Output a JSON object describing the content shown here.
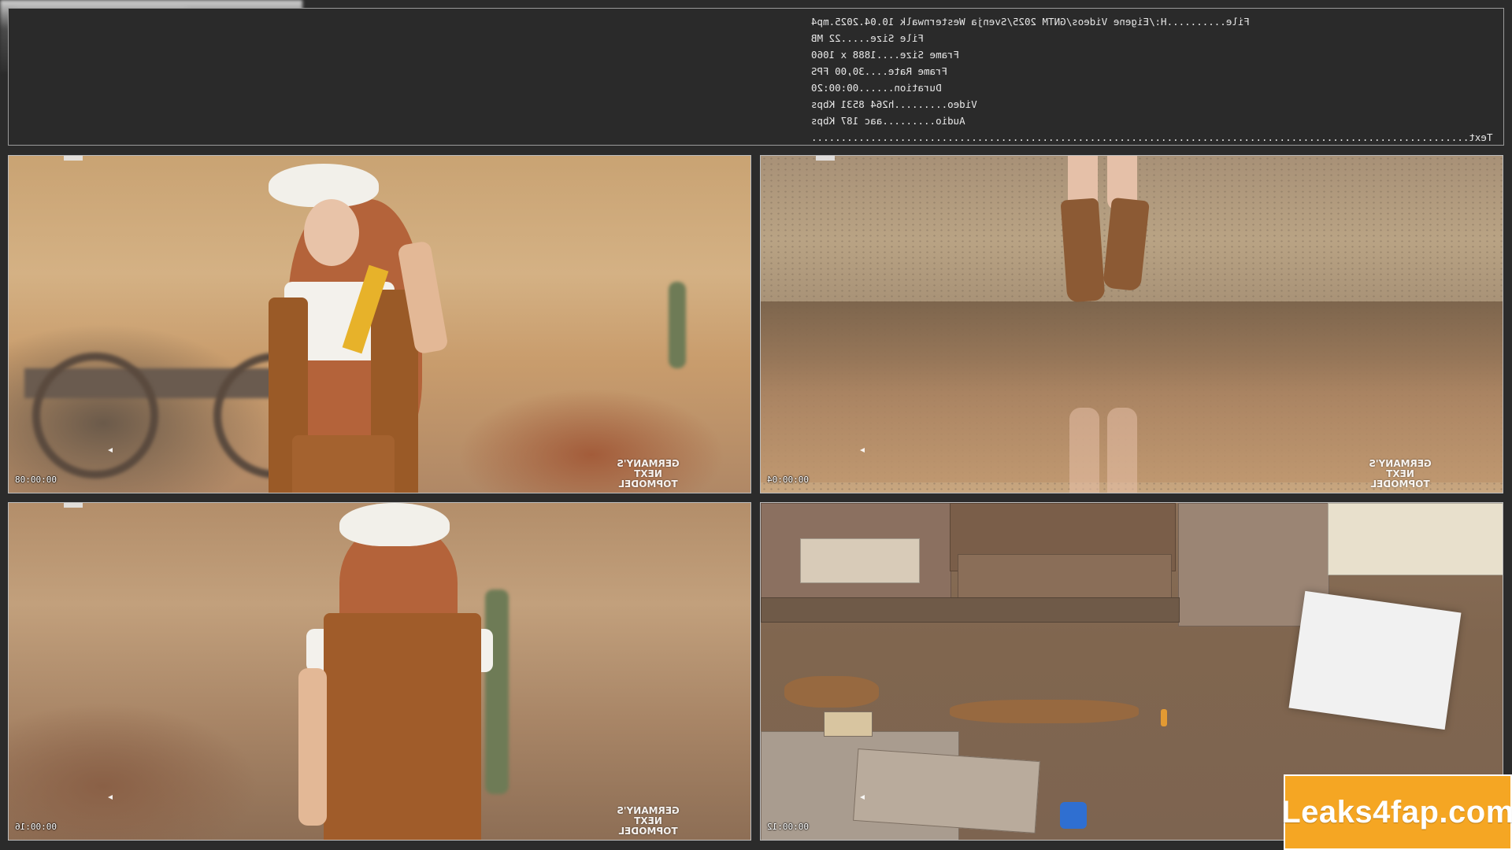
{
  "info": {
    "lines": [
      {
        "key": "File..........",
        "value": "H:/Eigene Videos/GNTM 2025/Svenja Westernwalk 10.04.2025.mp4"
      },
      {
        "key": "File Size.....",
        "value": "22 MB"
      },
      {
        "key": "Frame Size....",
        "value": "1888 x 1060"
      },
      {
        "key": "Frame Rate....",
        "value": "30,00 FPS"
      },
      {
        "key": "Duration......",
        "value": "00:00:20"
      },
      {
        "key": "Video.........",
        "value": "h264 8531 Kbps"
      },
      {
        "key": "Audio.........",
        "value": "aac 187 Kbps"
      },
      {
        "key": "Text..........",
        "value": "....................................................................................................."
      }
    ]
  },
  "thumbnails": [
    {
      "timestamp": "00:00:08",
      "logo": [
        "GERMANY'S",
        "NEXT",
        "TOPMODEL"
      ]
    },
    {
      "timestamp": "00:00:04",
      "logo": [
        "GERMANY'S",
        "NEXT",
        "TOPMODEL"
      ]
    },
    {
      "timestamp": "00:00:16",
      "logo": [
        "GERMANY'S",
        "NEXT",
        "TOPMODEL"
      ]
    },
    {
      "timestamp": "00:00:12",
      "logo": []
    }
  ],
  "badge": {
    "text": "Leaks4fap.com",
    "color": "#f5a623"
  }
}
